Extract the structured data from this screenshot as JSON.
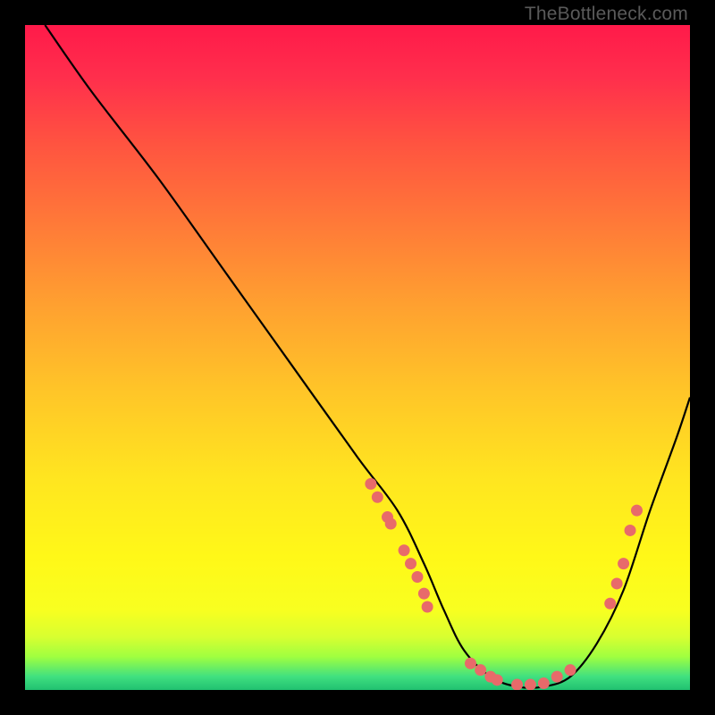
{
  "watermark": "TheBottleneck.com",
  "chart_data": {
    "type": "line",
    "title": "",
    "xlabel": "",
    "ylabel": "",
    "xlim": [
      0,
      100
    ],
    "ylim": [
      0,
      100
    ],
    "grid": false,
    "series": [
      {
        "name": "curve",
        "x": [
          3,
          10,
          20,
          30,
          40,
          50,
          56,
          60,
          63,
          66,
          70,
          74,
          78,
          82,
          86,
          90,
          94,
          98,
          100
        ],
        "y": [
          100,
          90,
          77,
          63,
          49,
          35,
          27,
          19,
          12,
          6,
          2,
          0.5,
          0.5,
          2,
          7,
          15,
          27,
          38,
          44
        ]
      }
    ],
    "dot_clusters": [
      {
        "name": "left-slope-dots",
        "points": [
          [
            52,
            31
          ],
          [
            53,
            29
          ],
          [
            54.5,
            26
          ],
          [
            55,
            25
          ],
          [
            57,
            21
          ],
          [
            58,
            19
          ],
          [
            59,
            17
          ],
          [
            60,
            14.5
          ],
          [
            60.5,
            12.5
          ]
        ]
      },
      {
        "name": "valley-dots",
        "points": [
          [
            67,
            4
          ],
          [
            68.5,
            3
          ],
          [
            70,
            2
          ],
          [
            71,
            1.5
          ],
          [
            74,
            0.8
          ],
          [
            76,
            0.8
          ],
          [
            78,
            1
          ],
          [
            80,
            2
          ],
          [
            82,
            3
          ]
        ]
      },
      {
        "name": "right-slope-dots",
        "points": [
          [
            88,
            13
          ],
          [
            89,
            16
          ],
          [
            90,
            19
          ],
          [
            91,
            24
          ],
          [
            92,
            27
          ]
        ]
      }
    ],
    "dot_color": "#e86a6a",
    "curve_color": "#000000"
  }
}
